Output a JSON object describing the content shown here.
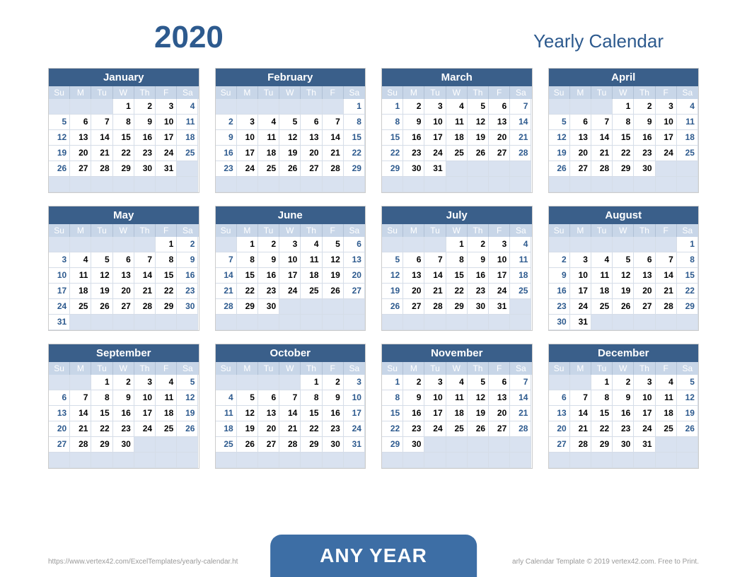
{
  "year": "2020",
  "title": "Yearly Calendar",
  "badge": "ANY YEAR",
  "footer_left": "https://www.vertex42.com/ExcelTemplates/yearly-calendar.ht",
  "footer_right": "arly Calendar Template © 2019 vertex42.com. Free to Print.",
  "dow": [
    "Su",
    "M",
    "Tu",
    "W",
    "Th",
    "F",
    "Sa"
  ],
  "months": [
    {
      "name": "January",
      "start": 3,
      "days": 31
    },
    {
      "name": "February",
      "start": 6,
      "days": 29
    },
    {
      "name": "March",
      "start": 0,
      "days": 31
    },
    {
      "name": "April",
      "start": 3,
      "days": 30
    },
    {
      "name": "May",
      "start": 5,
      "days": 31
    },
    {
      "name": "June",
      "start": 1,
      "days": 30
    },
    {
      "name": "July",
      "start": 3,
      "days": 31
    },
    {
      "name": "August",
      "start": 6,
      "days": 31
    },
    {
      "name": "September",
      "start": 2,
      "days": 30
    },
    {
      "name": "October",
      "start": 4,
      "days": 31
    },
    {
      "name": "November",
      "start": 0,
      "days": 30
    },
    {
      "name": "December",
      "start": 2,
      "days": 31
    }
  ]
}
